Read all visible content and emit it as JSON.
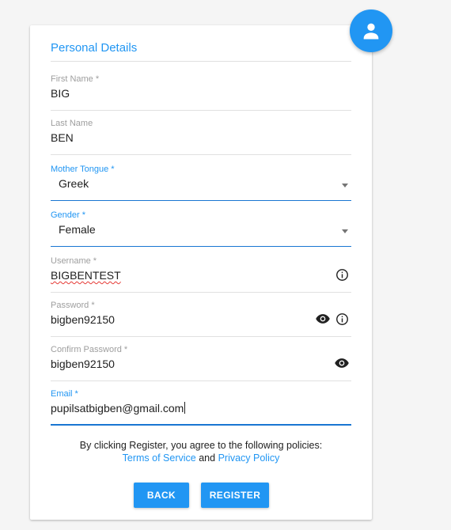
{
  "form": {
    "section_title": "Personal Details",
    "first_name": {
      "label": "First Name *",
      "value": "BIG"
    },
    "last_name": {
      "label": "Last Name",
      "value": "BEN"
    },
    "mother_tongue": {
      "label": "Mother Tongue *",
      "value": "Greek"
    },
    "gender": {
      "label": "Gender *",
      "value": "Female"
    },
    "username": {
      "label": "Username *",
      "value": "BIGBENTEST",
      "info_icon": "info-icon"
    },
    "password": {
      "label": "Password *",
      "value": "bigben92150",
      "icons": [
        "eye-icon",
        "info-icon"
      ]
    },
    "confirm_password": {
      "label": "Confirm Password *",
      "value": "bigben92150",
      "icons": [
        "eye-icon"
      ]
    },
    "email": {
      "label": "Email *",
      "value": "pupilsatbigben@gmail.com"
    }
  },
  "policy": {
    "text": "By clicking Register, you agree to the following policies:",
    "terms_link": "Terms of Service",
    "and_text": "and",
    "privacy_link": "Privacy Policy"
  },
  "buttons": {
    "back": "BACK",
    "register": "REGISTER"
  },
  "colors": {
    "accent": "#2196f3",
    "focus_underline": "#1976d2",
    "label_grey": "#9e9e9e"
  },
  "icons": {
    "avatar": "person-icon"
  }
}
